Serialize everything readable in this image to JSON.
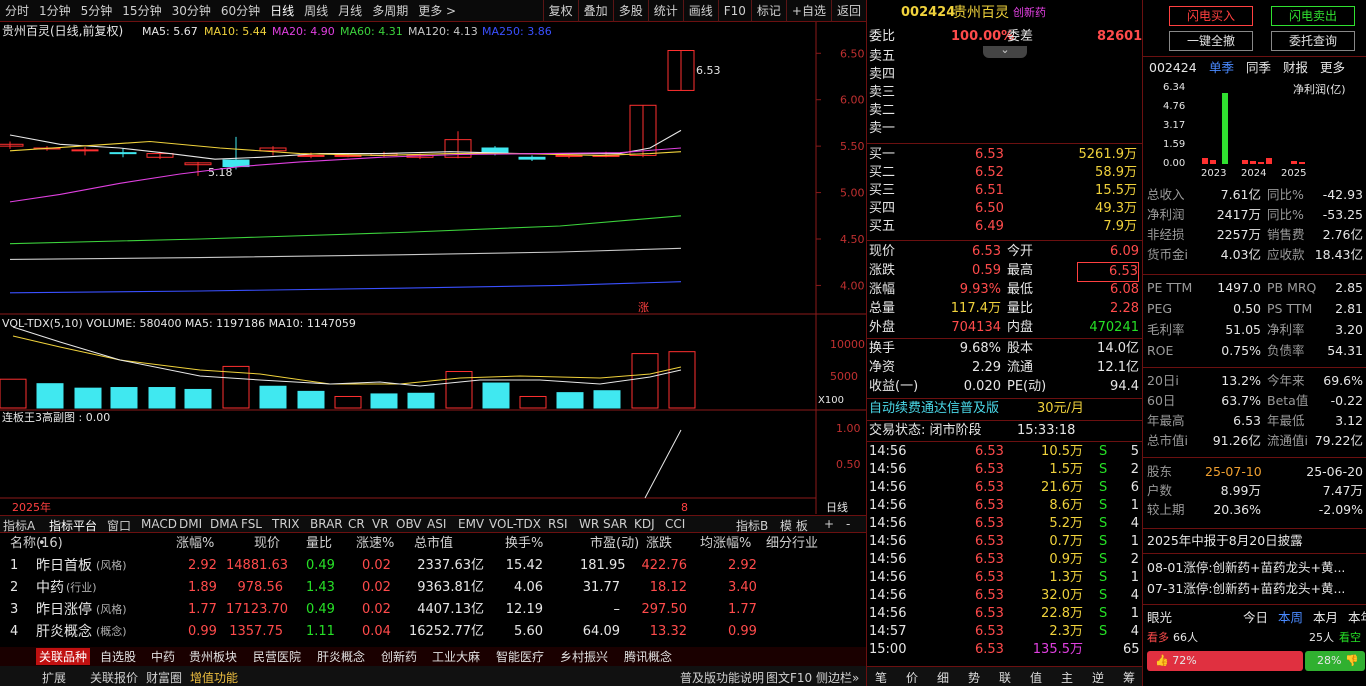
{
  "toolbar": {
    "items": [
      "分时",
      "1分钟",
      "5分钟",
      "15分钟",
      "30分钟",
      "60分钟",
      "日线",
      "周线",
      "月线",
      "多周期",
      "更多"
    ],
    "right": [
      "复权",
      "叠加",
      "多股",
      "统计",
      "画线",
      "F10",
      "标记",
      "+自选",
      "返回"
    ]
  },
  "chart": {
    "title": "贵州百灵(日线,前复权)",
    "ma": [
      {
        "label": "MA5: 5.67",
        "color": "#e8e8e8"
      },
      {
        "label": "MA10: 5.44",
        "color": "#f0d23c"
      },
      {
        "label": "MA20: 4.90",
        "color": "#e040e0"
      },
      {
        "label": "MA60: 4.31",
        "color": "#3cd23c"
      },
      {
        "label": "MA120: 4.13",
        "color": "#c8c8c8"
      },
      {
        "label": "MA250: 3.86",
        "color": "#3a50ff"
      }
    ],
    "y_ticks": [
      "6.50",
      "6.00",
      "5.50",
      "5.00",
      "4.50",
      "4.00"
    ],
    "high_label": "6.53",
    "low_label": "5.18",
    "zhang": "涨",
    "vol_title": "VOL-TDX(5,10) VOLUME: 580400 MA5: 1197186 MA10: 1147059",
    "vol_ticks": [
      "10000",
      "5000"
    ],
    "vol_unit": "X100",
    "ind_title": "连板王3高副图 : 0.00",
    "ind_ticks": [
      "1.00",
      "0.50"
    ],
    "year": "2025年",
    "month": "8",
    "period": "日线"
  },
  "tabs": {
    "left": [
      "指标A",
      "指标平台",
      "窗口",
      "MACD",
      "DMI",
      "DMA",
      "FSL",
      "TRIX",
      "BRAR",
      "CR",
      "VR",
      "OBV",
      "ASI",
      "EMV",
      "VOL-TDX",
      "RSI",
      "WR",
      "SAR",
      "KDJ",
      "CCI"
    ],
    "right": [
      "指标B",
      "模 板",
      "+",
      "-"
    ]
  },
  "table": {
    "headers": [
      "名称(16)",
      "•",
      "涨幅%",
      "现价",
      "量比",
      "涨速%",
      "总市值",
      "换手%",
      "市盈(动)",
      "涨跌",
      "均涨幅%",
      "细分行业"
    ],
    "rows": [
      {
        "i": "1",
        "name": "昨日首板",
        "tag": "(风格)",
        "pct": "2.92",
        "price": "14881.63",
        "lb": "0.49",
        "speed": "0.02",
        "cap": "2337.63亿",
        "hs": "15.42",
        "pe": "181.95",
        "chg": "422.76",
        "avg": "2.92"
      },
      {
        "i": "2",
        "name": "中药",
        "tag": "(行业)",
        "pct": "1.89",
        "price": "978.56",
        "lb": "1.43",
        "speed": "0.02",
        "cap": "9363.81亿",
        "hs": "4.06",
        "pe": "31.77",
        "chg": "18.12",
        "avg": "3.40"
      },
      {
        "i": "3",
        "name": "昨日涨停",
        "tag": "(风格)",
        "pct": "1.77",
        "price": "17123.70",
        "lb": "0.49",
        "speed": "0.02",
        "cap": "4407.13亿",
        "hs": "12.19",
        "pe": "–",
        "chg": "297.50",
        "avg": "1.77"
      },
      {
        "i": "4",
        "name": "肝炎概念",
        "tag": "(概念)",
        "pct": "0.99",
        "price": "1357.75",
        "lb": "1.11",
        "speed": "0.04",
        "cap": "16252.77亿",
        "hs": "5.60",
        "pe": "64.09",
        "chg": "13.32",
        "avg": "0.99"
      }
    ]
  },
  "bottom_tabs": [
    "关联品种",
    "自选股",
    "中药",
    "贵州板块",
    "民营医院",
    "肝炎概念",
    "创新药",
    "工业大麻",
    "智能医疗",
    "乡村振兴",
    "腾讯概念"
  ],
  "status": {
    "items": [
      "扩展",
      "关联报价",
      "财富圈",
      "增值功能"
    ],
    "right": [
      "普及版功能说明",
      "图文F10",
      "侧边栏»"
    ]
  },
  "quote": {
    "code": "002424",
    "name": "贵州百灵",
    "tag": "创新药",
    "wb_label": "委比",
    "wb": "100.00%",
    "wc_label": "委差",
    "wc": "82601",
    "asks": [
      "卖五",
      "卖四",
      "卖三",
      "卖二",
      "卖一"
    ],
    "bids": [
      {
        "l": "买一",
        "p": "6.53",
        "v": "5261.9万"
      },
      {
        "l": "买二",
        "p": "6.52",
        "v": "58.9万"
      },
      {
        "l": "买三",
        "p": "6.51",
        "v": "15.5万"
      },
      {
        "l": "买四",
        "p": "6.50",
        "v": "49.3万"
      },
      {
        "l": "买五",
        "p": "6.49",
        "v": "7.9万"
      }
    ],
    "stats": [
      {
        "a": "现价",
        "av": "6.53",
        "b": "今开",
        "bv": "6.09"
      },
      {
        "a": "涨跌",
        "av": "0.59",
        "b": "最高",
        "bv": "6.53"
      },
      {
        "a": "涨幅",
        "av": "9.93%",
        "b": "最低",
        "bv": "6.08"
      },
      {
        "a": "总量",
        "av": "117.4万",
        "b": "量比",
        "bv": "2.28"
      },
      {
        "a": "外盘",
        "av": "704134",
        "b": "内盘",
        "bv": "470241"
      }
    ],
    "stats2": [
      {
        "a": "换手",
        "av": "9.68%",
        "b": "股本",
        "bv": "14.0亿"
      },
      {
        "a": "净资",
        "av": "2.29",
        "b": "流通",
        "bv": "12.1亿"
      },
      {
        "a": "收益(一)",
        "av": "0.020",
        "b": "PE(动)",
        "bv": "94.4"
      }
    ],
    "ad": "自动续费通达信普及版",
    "ad_price": "30元/月",
    "state": "交易状态: 闭市阶段",
    "state_time": "15:33:18",
    "ticks": [
      [
        "14:56",
        "6.53",
        "10.5万",
        "S",
        "5"
      ],
      [
        "14:56",
        "6.53",
        "1.5万",
        "S",
        "2"
      ],
      [
        "14:56",
        "6.53",
        "21.6万",
        "S",
        "6"
      ],
      [
        "14:56",
        "6.53",
        "8.6万",
        "S",
        "1"
      ],
      [
        "14:56",
        "6.53",
        "5.2万",
        "S",
        "4"
      ],
      [
        "14:56",
        "6.53",
        "0.7万",
        "S",
        "1"
      ],
      [
        "14:56",
        "6.53",
        "0.9万",
        "S",
        "2"
      ],
      [
        "14:56",
        "6.53",
        "1.3万",
        "S",
        "1"
      ],
      [
        "14:56",
        "6.53",
        "32.0万",
        "S",
        "4"
      ],
      [
        "14:56",
        "6.53",
        "22.8万",
        "S",
        "1"
      ],
      [
        "14:57",
        "6.53",
        "2.3万",
        "S",
        "4"
      ],
      [
        "15:00",
        "6.53",
        "135.5万",
        "",
        "65"
      ]
    ],
    "bottom": [
      "笔",
      "价",
      "细",
      "势",
      "联",
      "值",
      "主",
      "逆",
      "筹"
    ]
  },
  "side": {
    "buttons": [
      "闪电买入",
      "闪电卖出",
      "一键全撤",
      "委托查询"
    ],
    "code": "002424",
    "tabs": [
      "单季",
      "同季",
      "财报",
      "更多"
    ],
    "fin_label": "净利润(亿)",
    "fin_y": [
      "6.34",
      "4.76",
      "3.17",
      "1.59",
      "0.00"
    ],
    "fin_x": [
      "2023",
      "2024",
      "2025"
    ],
    "rows": [
      [
        "总收入",
        "7.61亿",
        "同比%",
        "-42.93"
      ],
      [
        "净利润",
        "2417万",
        "同比%",
        "-53.25"
      ],
      [
        "非经损",
        "2257万",
        "销售费",
        "2.76亿"
      ],
      [
        "货币金i",
        "4.03亿",
        "应收款",
        "18.43亿"
      ],
      [
        "PE TTM",
        "1497.0",
        "PB MRQ",
        "2.85"
      ],
      [
        "PEG",
        "0.50",
        "PS TTM",
        "2.81"
      ],
      [
        "毛利率",
        "51.05",
        "净利率",
        "3.20"
      ],
      [
        "ROE",
        "0.75%",
        "负债率",
        "54.31"
      ],
      [
        "20日i",
        "13.2%",
        "今年来",
        "69.6%"
      ],
      [
        "60日",
        "63.7%",
        "Beta值",
        "-0.22"
      ],
      [
        "年最高",
        "6.53",
        "年最低",
        "3.12"
      ],
      [
        "总市值i",
        "91.26亿",
        "流通值i",
        "79.22亿"
      ],
      [
        "股东",
        "25-07-10",
        "",
        "25-06-20"
      ],
      [
        "户数",
        "8.99万",
        "",
        "7.47万"
      ],
      [
        "较上期",
        "20.36%",
        "",
        "-2.09%"
      ]
    ],
    "notice": "2025年中报于8月20日披露",
    "news": [
      "08-01涨停:创新药+苗药龙头+黄...",
      "07-31涨停:创新药+苗药龙头+黄..."
    ],
    "eye": "眼光",
    "eye_tabs": [
      "今日",
      "本周",
      "本月",
      "本年"
    ],
    "bull": "看多",
    "bull_n": "66人",
    "bear_n": "25人",
    "bear": "看空",
    "bull_pct": "72%",
    "bear_pct": "28%"
  }
}
